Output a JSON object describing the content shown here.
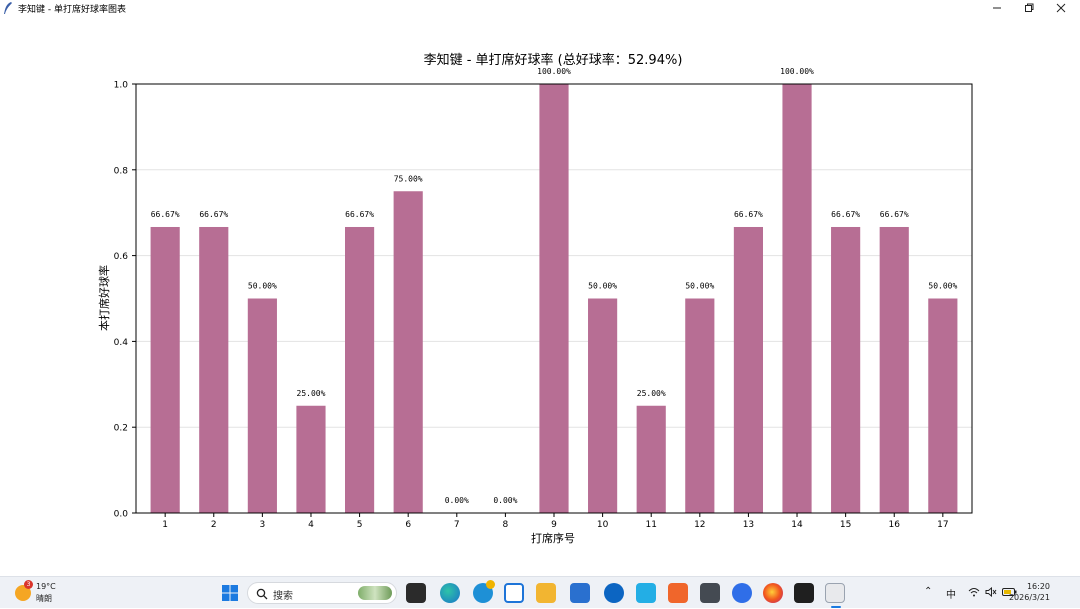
{
  "window": {
    "title": "李知键 - 单打席好球率图表",
    "minimize_icon": "minimize-icon",
    "restore_icon": "restore-icon",
    "close_icon": "close-icon"
  },
  "chart_data": {
    "type": "bar",
    "title": "李知键 - 单打席好球率 (总好球率：52.94%)",
    "xlabel": "打席序号",
    "ylabel": "本打席好球率",
    "categories": [
      "1",
      "2",
      "3",
      "4",
      "5",
      "6",
      "7",
      "8",
      "9",
      "10",
      "11",
      "12",
      "13",
      "14",
      "15",
      "16",
      "17"
    ],
    "values": [
      0.6667,
      0.6667,
      0.5,
      0.25,
      0.6667,
      0.75,
      0.0,
      0.0,
      1.0,
      0.5,
      0.25,
      0.5,
      0.6667,
      1.0,
      0.6667,
      0.6667,
      0.5
    ],
    "data_labels": [
      "66.67%",
      "66.67%",
      "50.00%",
      "25.00%",
      "66.67%",
      "75.00%",
      "0.00%",
      "0.00%",
      "100.00%",
      "50.00%",
      "25.00%",
      "50.00%",
      "66.67%",
      "100.00%",
      "66.67%",
      "66.67%",
      "50.00%"
    ],
    "yticks": [
      "0.0",
      "0.2",
      "0.4",
      "0.6",
      "0.8",
      "1.0"
    ],
    "ylim": [
      0,
      1.0
    ],
    "grid": "horizontal",
    "bar_color": "#b76e94"
  },
  "taskbar": {
    "weather_temp": "19°C",
    "weather_desc": "晴朗",
    "weather_badge": "3",
    "search_placeholder": "搜索",
    "ime": "中",
    "time": "16:20",
    "date": "2026/3/21"
  }
}
